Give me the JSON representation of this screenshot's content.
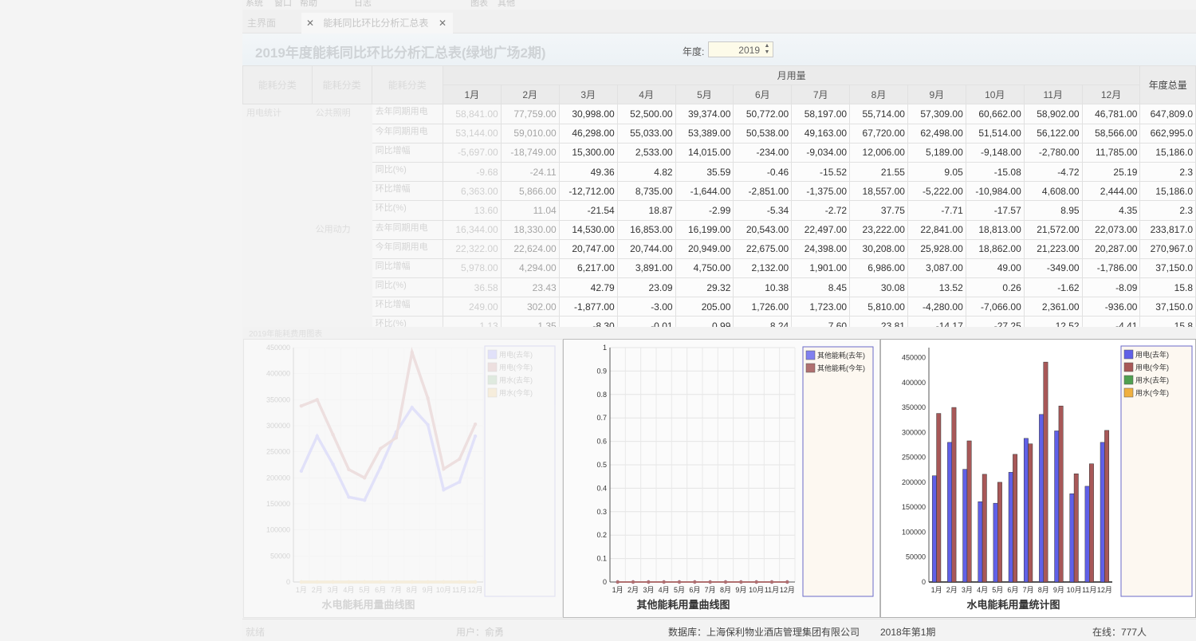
{
  "menu": {
    "items": [
      "系统",
      "窗口",
      "帮助",
      "图表",
      "其他",
      "日志"
    ]
  },
  "tabs": [
    {
      "label": "主界面"
    },
    {
      "label": "能耗同比环比分析汇总表"
    }
  ],
  "header": {
    "title": "2019年度能耗同比环比分析汇总表(绿地广场2期)",
    "year_label": "年度:",
    "year_value": "2019"
  },
  "table": {
    "group_header": "月用量",
    "total_header": "年度总量",
    "category_headers": [
      "能耗分类",
      "能耗分类",
      "能耗分类"
    ],
    "months": [
      "1月",
      "2月",
      "3月",
      "4月",
      "5月",
      "6月",
      "7月",
      "8月",
      "9月",
      "10月",
      "11月",
      "12月"
    ],
    "level1": "用电统计",
    "groups": [
      {
        "name": "公共照明",
        "rows": [
          {
            "label": "去年同期用电",
            "values": [
              "58,841.00",
              "77,759.00",
              "30,998.00",
              "52,500.00",
              "39,374.00",
              "50,772.00",
              "58,197.00",
              "55,714.00",
              "57,309.00",
              "60,662.00",
              "58,902.00",
              "46,781.00"
            ],
            "total": "647,809.0"
          },
          {
            "label": "今年同期用电",
            "values": [
              "53,144.00",
              "59,010.00",
              "46,298.00",
              "55,033.00",
              "53,389.00",
              "50,538.00",
              "49,163.00",
              "67,720.00",
              "62,498.00",
              "51,514.00",
              "56,122.00",
              "58,566.00"
            ],
            "total": "662,995.0"
          },
          {
            "label": "同比增幅",
            "values": [
              "-5,697.00",
              "-18,749.00",
              "15,300.00",
              "2,533.00",
              "14,015.00",
              "-234.00",
              "-9,034.00",
              "12,006.00",
              "5,189.00",
              "-9,148.00",
              "-2,780.00",
              "11,785.00"
            ],
            "total": "15,186.0"
          },
          {
            "label": "同比(%)",
            "values": [
              "-9.68",
              "-24.11",
              "49.36",
              "4.82",
              "35.59",
              "-0.46",
              "-15.52",
              "21.55",
              "9.05",
              "-15.08",
              "-4.72",
              "25.19"
            ],
            "total": "2.3"
          },
          {
            "label": "环比增幅",
            "values": [
              "6,363.00",
              "5,866.00",
              "-12,712.00",
              "8,735.00",
              "-1,644.00",
              "-2,851.00",
              "-1,375.00",
              "18,557.00",
              "-5,222.00",
              "-10,984.00",
              "4,608.00",
              "2,444.00"
            ],
            "total": "15,186.0"
          },
          {
            "label": "环比(%)",
            "values": [
              "13.60",
              "11.04",
              "-21.54",
              "18.87",
              "-2.99",
              "-5.34",
              "-2.72",
              "37.75",
              "-7.71",
              "-17.57",
              "8.95",
              "4.35"
            ],
            "total": "2.3"
          }
        ]
      },
      {
        "name": "公用动力",
        "rows": [
          {
            "label": "去年同期用电",
            "values": [
              "16,344.00",
              "18,330.00",
              "14,530.00",
              "16,853.00",
              "16,199.00",
              "20,543.00",
              "22,497.00",
              "23,222.00",
              "22,841.00",
              "18,813.00",
              "21,572.00",
              "22,073.00"
            ],
            "total": "233,817.0"
          },
          {
            "label": "今年同期用电",
            "values": [
              "22,322.00",
              "22,624.00",
              "20,747.00",
              "20,744.00",
              "20,949.00",
              "22,675.00",
              "24,398.00",
              "30,208.00",
              "25,928.00",
              "18,862.00",
              "21,223.00",
              "20,287.00"
            ],
            "total": "270,967.0"
          },
          {
            "label": "同比增幅",
            "values": [
              "5,978.00",
              "4,294.00",
              "6,217.00",
              "3,891.00",
              "4,750.00",
              "2,132.00",
              "1,901.00",
              "6,986.00",
              "3,087.00",
              "49.00",
              "-349.00",
              "-1,786.00"
            ],
            "total": "37,150.0"
          },
          {
            "label": "同比(%)",
            "values": [
              "36.58",
              "23.43",
              "42.79",
              "23.09",
              "29.32",
              "10.38",
              "8.45",
              "30.08",
              "13.52",
              "0.26",
              "-1.62",
              "-8.09"
            ],
            "total": "15.8"
          },
          {
            "label": "环比增幅",
            "values": [
              "249.00",
              "302.00",
              "-1,877.00",
              "-3.00",
              "205.00",
              "1,726.00",
              "1,723.00",
              "5,810.00",
              "-4,280.00",
              "-7,066.00",
              "2,361.00",
              "-936.00"
            ],
            "total": "37,150.0"
          },
          {
            "label": "环比(%)",
            "values": [
              "1.13",
              "1.35",
              "-8.30",
              "-0.01",
              "0.99",
              "8.24",
              "7.60",
              "23.81",
              "-14.17",
              "-27.25",
              "12.52",
              "-4.41"
            ],
            "total": "15.8"
          }
        ]
      }
    ]
  },
  "charts_caption": "2019年能耗费用图表",
  "chart_data": [
    {
      "type": "line",
      "title": "水电能耗用量曲线图",
      "categories": [
        "1月",
        "2月",
        "3月",
        "4月",
        "5月",
        "6月",
        "7月",
        "8月",
        "9月",
        "10月",
        "11月",
        "12月"
      ],
      "ylim": [
        0,
        450000
      ],
      "yticks": [
        0,
        50000,
        100000,
        150000,
        200000,
        250000,
        300000,
        350000,
        400000,
        450000
      ],
      "series": [
        {
          "name": "用电(去年)",
          "color": "#8080ff",
          "values": [
            213000,
            280000,
            226000,
            163000,
            157000,
            220000,
            288000,
            335000,
            302000,
            177000,
            192000,
            280000
          ]
        },
        {
          "name": "用电(今年)",
          "color": "#c07070",
          "values": [
            338000,
            350000,
            283000,
            216000,
            200000,
            256000,
            277000,
            441000,
            353000,
            217000,
            236000,
            303000
          ]
        },
        {
          "name": "用水(去年)",
          "color": "#70b070",
          "values": [
            0,
            0,
            0,
            0,
            0,
            0,
            0,
            0,
            0,
            0,
            0,
            0
          ]
        },
        {
          "name": "用水(今年)",
          "color": "#f0c060",
          "values": [
            0,
            0,
            0,
            0,
            0,
            0,
            0,
            0,
            0,
            0,
            0,
            0
          ]
        }
      ]
    },
    {
      "type": "line",
      "title": "其他能耗用量曲线图",
      "categories": [
        "1月",
        "2月",
        "3月",
        "4月",
        "5月",
        "6月",
        "7月",
        "8月",
        "9月",
        "10月",
        "11月",
        "12月"
      ],
      "ylim": [
        0,
        1
      ],
      "yticks": [
        0,
        0.1,
        0.2,
        0.3,
        0.4,
        0.5,
        0.6,
        0.7,
        0.8,
        0.9,
        1
      ],
      "series": [
        {
          "name": "其他能耗(去年)",
          "color": "#8080f0",
          "values": [
            0,
            0,
            0,
            0,
            0,
            0,
            0,
            0,
            0,
            0,
            0,
            0
          ]
        },
        {
          "name": "其他能耗(今年)",
          "color": "#b07070",
          "values": [
            0,
            0,
            0,
            0,
            0,
            0,
            0,
            0,
            0,
            0,
            0,
            0
          ]
        }
      ]
    },
    {
      "type": "bar",
      "title": "水电能耗用量统计图",
      "categories": [
        "1月",
        "2月",
        "3月",
        "4月",
        "5月",
        "6月",
        "7月",
        "8月",
        "9月",
        "10月",
        "11月",
        "12月"
      ],
      "ylim": [
        0,
        470000
      ],
      "yticks": [
        0,
        50000,
        100000,
        150000,
        200000,
        250000,
        300000,
        350000,
        400000,
        450000
      ],
      "series": [
        {
          "name": "用电(去年)",
          "color": "#6060e8",
          "values": [
            213000,
            280000,
            226000,
            161000,
            158000,
            220000,
            288000,
            336000,
            303000,
            177000,
            192000,
            280000
          ]
        },
        {
          "name": "用电(今年)",
          "color": "#a85858",
          "values": [
            338000,
            350000,
            283000,
            216000,
            200000,
            256000,
            277000,
            441000,
            353000,
            217000,
            237000,
            304000
          ]
        },
        {
          "name": "用水(去年)",
          "color": "#50a050",
          "values": [
            0,
            0,
            0,
            0,
            0,
            0,
            0,
            0,
            0,
            0,
            0,
            0
          ]
        },
        {
          "name": "用水(今年)",
          "color": "#f0b040",
          "values": [
            0,
            0,
            0,
            0,
            0,
            0,
            0,
            0,
            0,
            0,
            0,
            0
          ]
        }
      ]
    }
  ],
  "status": {
    "left": "就绪",
    "user": "用户：俞勇",
    "database": "数据库：上海保利物业酒店管理集团有限公司",
    "period": "2018年第1期",
    "online": "在线：777人"
  }
}
